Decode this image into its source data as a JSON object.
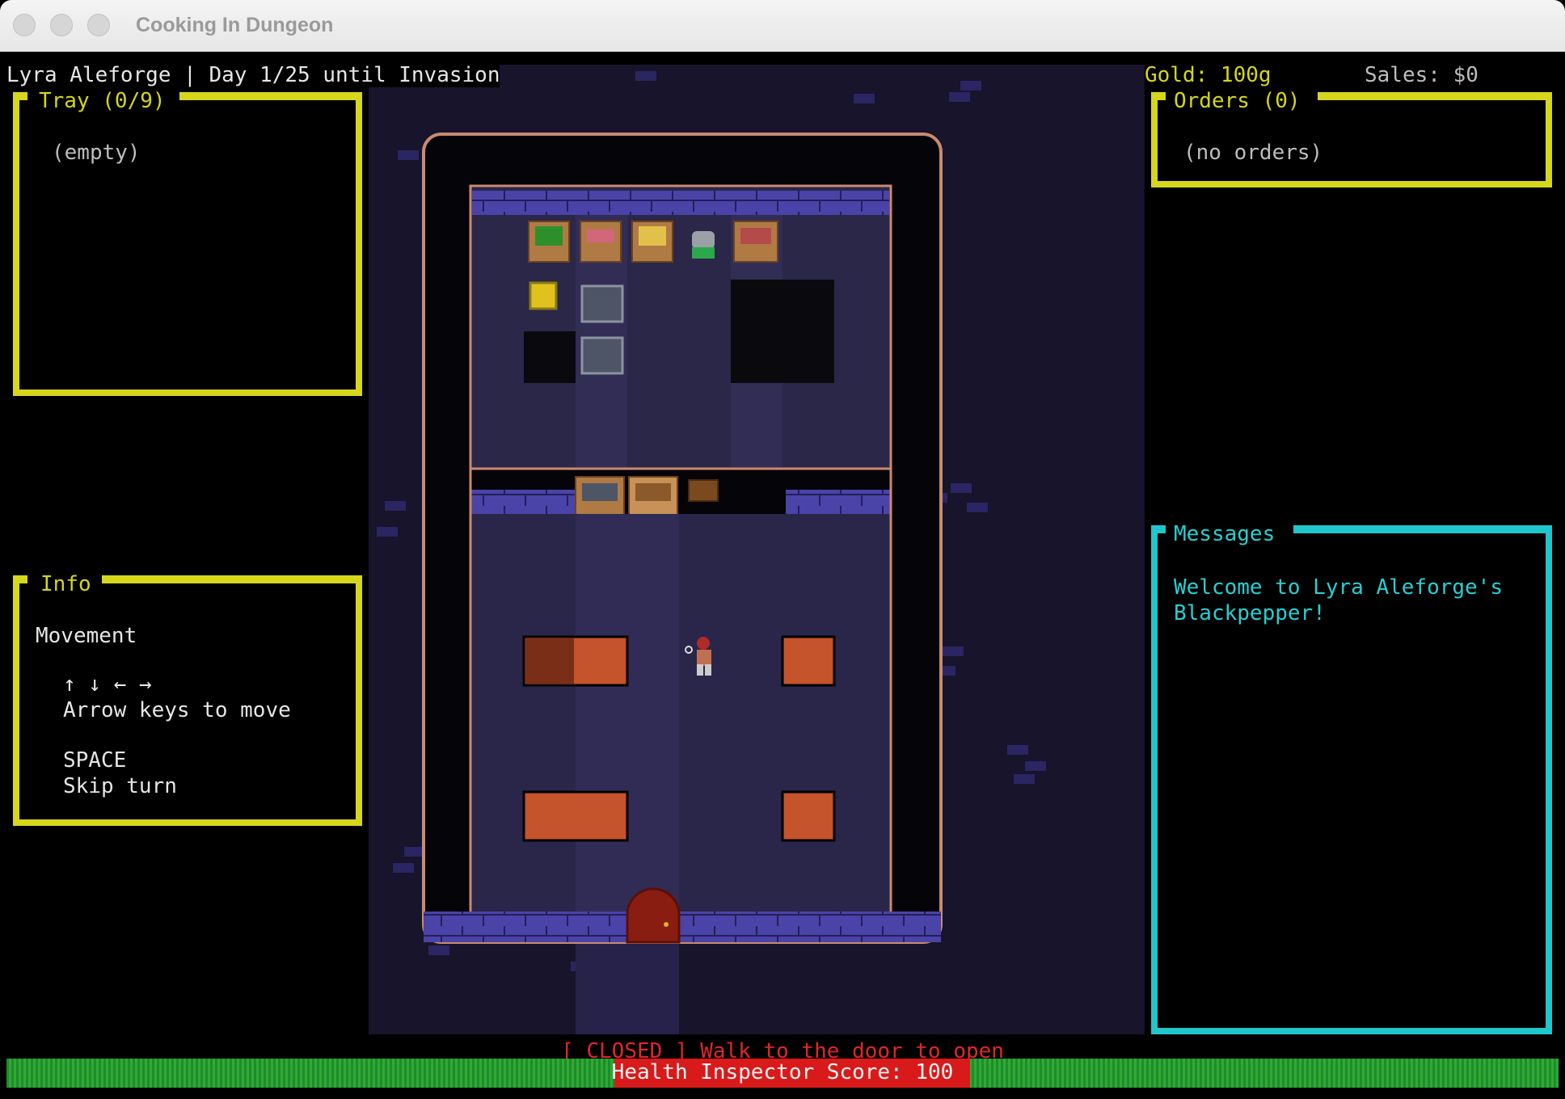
{
  "window": {
    "title": "Cooking In Dungeon"
  },
  "hud": {
    "status_line": "Lyra Aleforge | Day 1/25 until Invasion",
    "gold": "Gold: 100g",
    "sales": "Sales: $0"
  },
  "tray": {
    "title": "Tray (0/9)",
    "content": "(empty)"
  },
  "info": {
    "title": "Info",
    "heading": "Movement",
    "arrows": "↑ ↓ ← →",
    "move_help": "Arrow keys to move",
    "space_key": "SPACE",
    "space_help": "Skip turn"
  },
  "orders": {
    "title": "Orders (0)",
    "content": "(no orders)"
  },
  "messages": {
    "title": "Messages",
    "lines": [
      "Welcome to Lyra Aleforge's",
      "Blackpepper!"
    ]
  },
  "footer": {
    "status": "[ CLOSED ] Walk to the door to open",
    "health_label": "Health Inspector Score: 100",
    "health_score": 100
  },
  "colors": {
    "panel_yellow": "#d6d61c",
    "panel_cyan": "#1fc6cc",
    "closed_red": "#e0262a",
    "health_green": "#2faa35",
    "health_red": "#d91a1a"
  },
  "icons": [
    "chest-of-greens",
    "chest-of-meat",
    "chest-of-bread",
    "cooking-pot",
    "chest-of-fish",
    "player-character",
    "arched-door"
  ]
}
